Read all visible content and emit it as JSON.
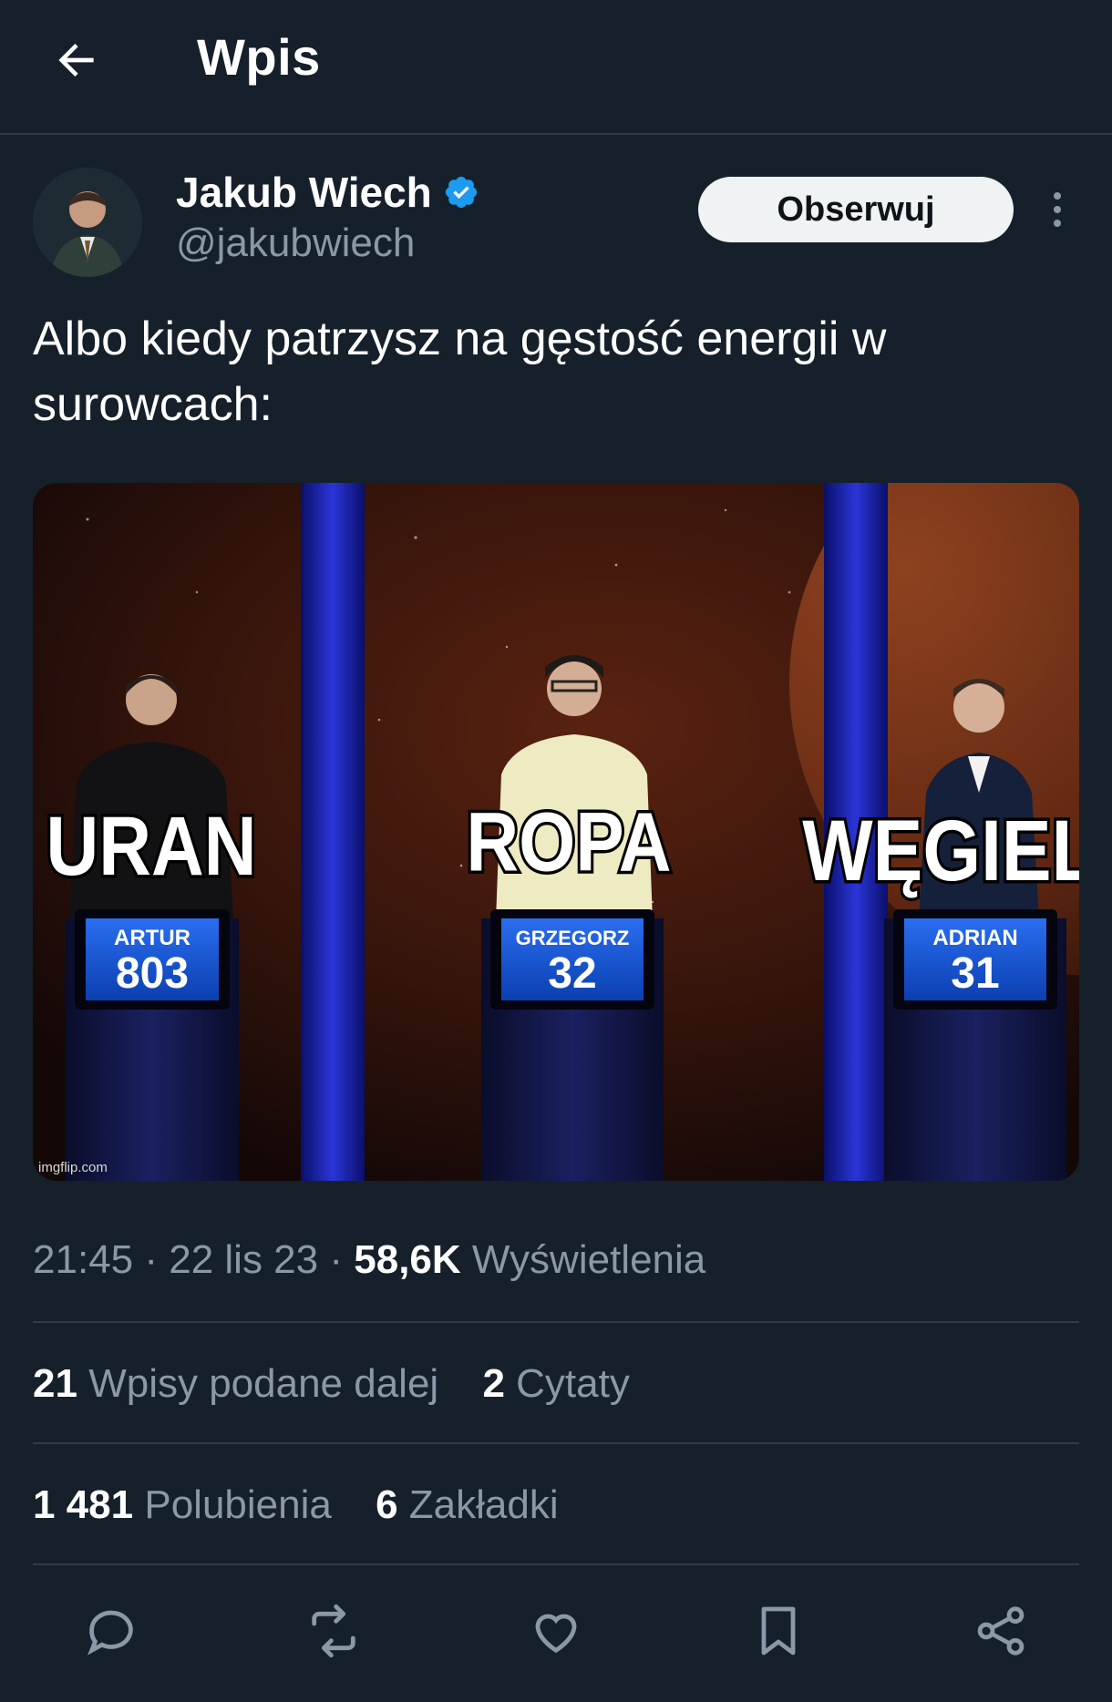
{
  "header": {
    "title": "Wpis",
    "back_icon": "arrow-left-icon"
  },
  "author": {
    "name": "Jakub Wiech",
    "handle": "@jakubwiech",
    "verified_icon": "verified-badge-icon",
    "verified_color": "#1d9bf0"
  },
  "follow_label": "Obserwuj",
  "more_icon": "more-vertical-icon",
  "tweet_text": "Albo kiedy patrzysz na gęstość energii w surowcach:",
  "meme": {
    "captions": [
      "URAN",
      "ROPA",
      "WĘGIEL"
    ],
    "contestants": [
      {
        "name": "ARTUR",
        "score": "803"
      },
      {
        "name": "GRZEGORZ",
        "score": "32"
      },
      {
        "name": "ADRIAN",
        "score": "31"
      }
    ],
    "watermark": "imgflip.com"
  },
  "meta": {
    "time": "21:45",
    "date": "22 lis 23",
    "views_count": "58,6K",
    "views_label": "Wyświetlenia",
    "separator": "·"
  },
  "stats": {
    "reposts_count": "21",
    "reposts_label": "Wpisy podane dalej",
    "quotes_count": "2",
    "quotes_label": "Cytaty",
    "likes_count": "1 481",
    "likes_label": "Polubienia",
    "bookmarks_count": "6",
    "bookmarks_label": "Zakładki"
  },
  "actions": [
    "reply-icon",
    "repost-icon",
    "like-icon",
    "bookmark-icon",
    "share-icon"
  ],
  "colors": {
    "background": "#15202b",
    "secondary_text": "#8b98a5",
    "divider": "#2f3b47",
    "accent": "#1d9bf0"
  }
}
